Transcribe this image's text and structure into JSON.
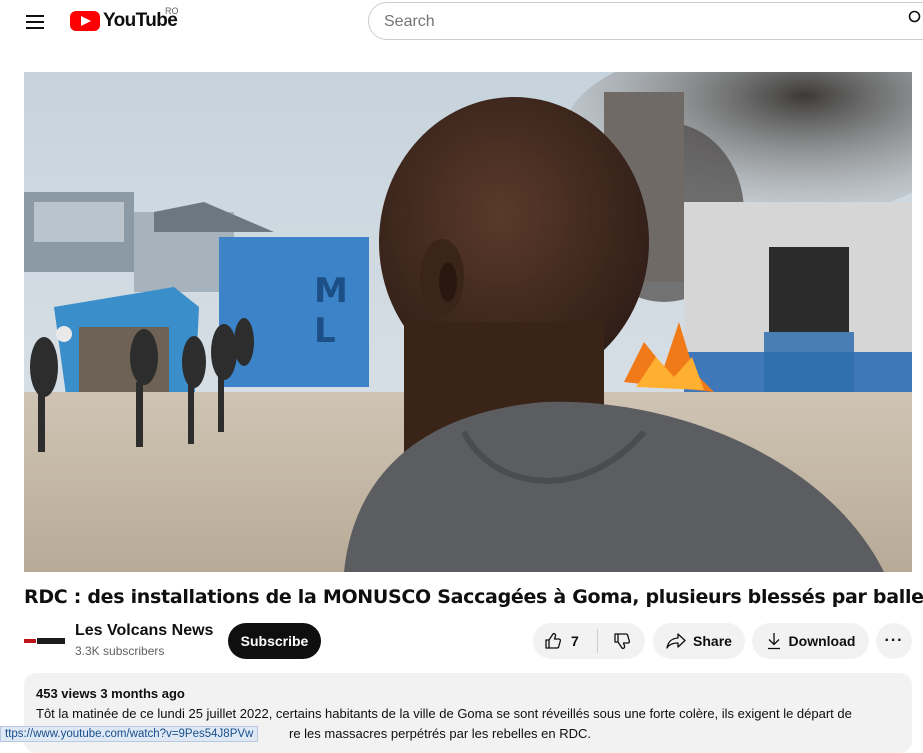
{
  "header": {
    "logo_text": "YouTube",
    "region": "RO",
    "search_placeholder": "Search",
    "menu_icon": "hamburger-menu-icon",
    "search_icon": "search-icon"
  },
  "video": {
    "title": "RDC : des installations de la MONUSCO Saccagées à Goma, plusieurs blessés par balles"
  },
  "channel": {
    "name": "Les Volcans News",
    "subscribers": "3.3K subscribers",
    "subscribe_label": "Subscribe"
  },
  "actions": {
    "like_count": "7",
    "share_label": "Share",
    "download_label": "Download",
    "more_label": "···"
  },
  "description": {
    "meta": "453 views  3 months ago",
    "line1": "Tôt la matinée de ce lundi 25 juillet 2022, certains habitants de la ville de Goma se sont réveillés sous une forte colère, ils exigent le départ de",
    "line2_visible": "re les massacres perpétrés par les rebelles en RDC."
  },
  "status_bar": {
    "url": "ttps://www.youtube.com/watch?v=9Pes54J8PVw"
  },
  "colors": {
    "brand_red": "#ff0000",
    "pill_bg": "#f2f2f2",
    "subscribe_bg": "#0f0f0f"
  }
}
